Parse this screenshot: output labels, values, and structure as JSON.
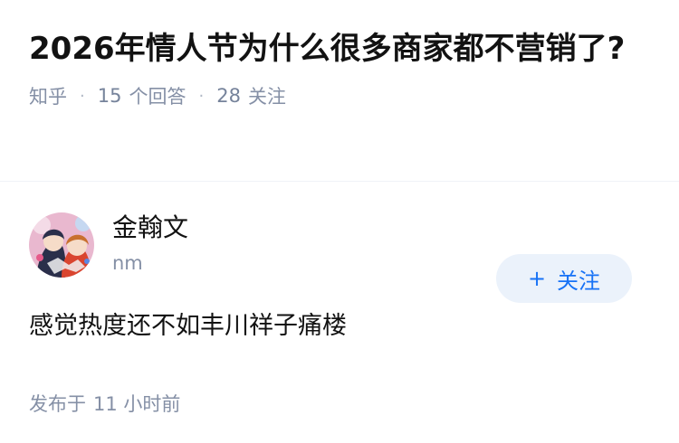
{
  "question": {
    "title": "2026年情人节为什么很多商家都不营销了?",
    "source": "知乎",
    "answer_count": "15",
    "answer_label": "个回答",
    "follower_count": "28",
    "follower_label": "关注"
  },
  "answer": {
    "author_name": "金翰文",
    "author_bio": "nm",
    "follow_button": "关注",
    "follow_icon": "plus-icon",
    "content": "感觉热度还不如丰川祥子痛楼",
    "published_label": "发布于",
    "published_time": "11 小时前"
  },
  "colors": {
    "accent": "#1772f6",
    "follow_bg": "#ebf2fb",
    "meta_gray": "#8590a6"
  }
}
